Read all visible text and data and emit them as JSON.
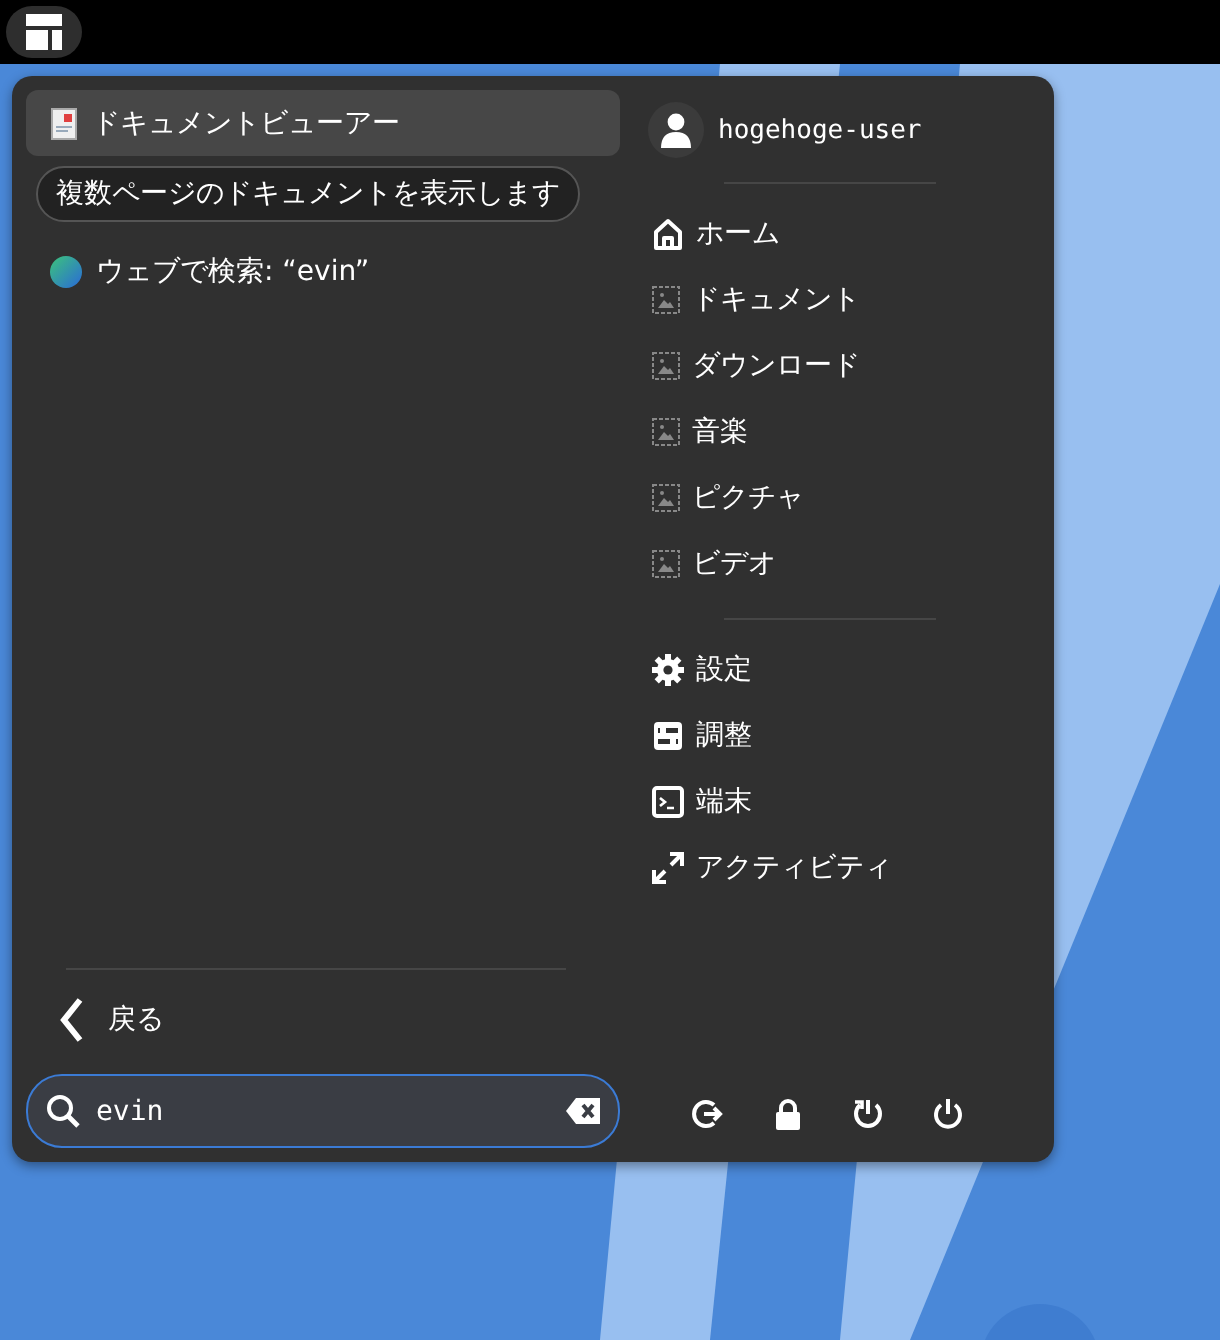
{
  "results": [
    {
      "kind": "app",
      "label": "ドキュメントビューアー",
      "selected": true,
      "tooltip": "複数ページのドキュメントを表示します"
    },
    {
      "kind": "web",
      "label": "ウェブで検索: “evin”",
      "selected": false
    }
  ],
  "back": {
    "label": "戻る"
  },
  "search": {
    "value": "evin"
  },
  "user": {
    "name": "hogehoge-user"
  },
  "places": [
    {
      "kind": "home",
      "label": "ホーム"
    },
    {
      "kind": "folder",
      "label": "ドキュメント"
    },
    {
      "kind": "folder",
      "label": "ダウンロード"
    },
    {
      "kind": "folder",
      "label": "音楽"
    },
    {
      "kind": "folder",
      "label": "ピクチャ"
    },
    {
      "kind": "folder",
      "label": "ビデオ"
    }
  ],
  "system": [
    {
      "kind": "settings",
      "label": "設定"
    },
    {
      "kind": "tweaks",
      "label": "調整"
    },
    {
      "kind": "terminal",
      "label": "端末"
    },
    {
      "kind": "activities",
      "label": "アクティビティ"
    }
  ],
  "session_buttons": [
    {
      "kind": "logout"
    },
    {
      "kind": "lock"
    },
    {
      "kind": "restart"
    },
    {
      "kind": "power"
    }
  ]
}
